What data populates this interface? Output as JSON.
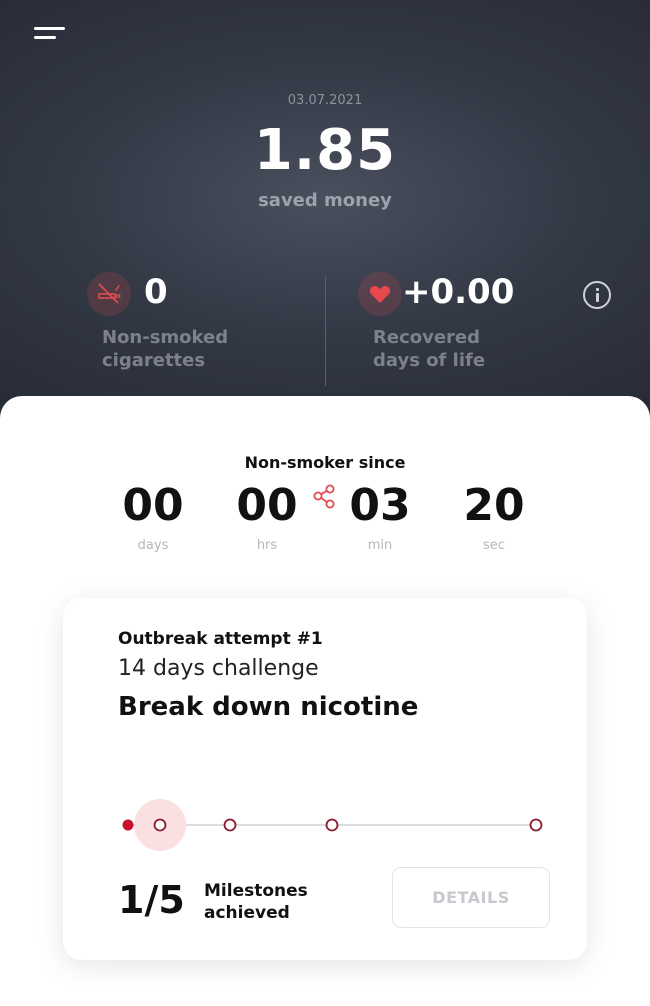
{
  "header": {
    "date": "03.07.2021",
    "amount": "1.85",
    "amount_label": "saved money"
  },
  "stats": {
    "cigarettes": {
      "value": "0",
      "label_line1": "Non-smoked",
      "label_line2": "cigarettes",
      "icon": "no-smoking-icon"
    },
    "life": {
      "value": "+0.00",
      "label_line1": "Recovered",
      "label_line2": "days of life",
      "icon": "heart-icon"
    }
  },
  "timer": {
    "title": "Non-smoker since",
    "days": "00",
    "days_unit": "days",
    "hours": "00",
    "hours_unit": "hrs",
    "minutes": "03",
    "minutes_unit": "min",
    "seconds": "20",
    "seconds_unit": "sec"
  },
  "challenge": {
    "attempt": "Outbreak attempt #1",
    "name": "14 days challenge",
    "goal": "Break down nicotine",
    "milestones_done": 1,
    "milestones_total": 5,
    "milestones_count": "1/5",
    "milestones_label_line1": "Milestones",
    "milestones_label_line2": "achieved",
    "details_label": "DETAILS"
  },
  "colors": {
    "accent": "#c8102e",
    "bg_dark": "#2c303b"
  }
}
